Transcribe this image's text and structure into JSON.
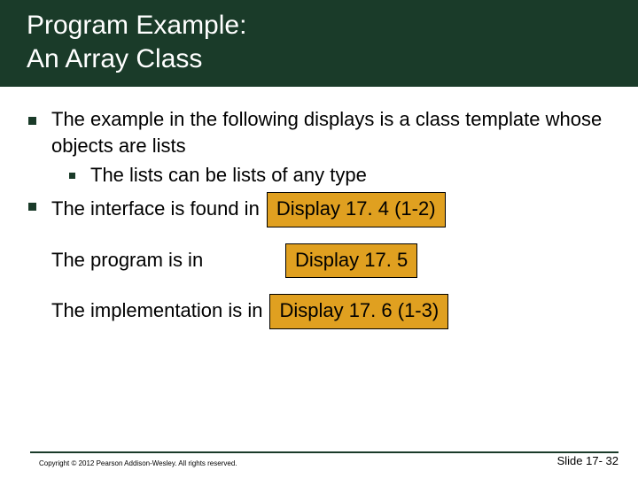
{
  "title": {
    "line1": "Program Example:",
    "line2": "An Array Class"
  },
  "content": {
    "bullet1": "The example in the following displays is a class template whose objects are lists",
    "sub1": "The lists can be lists of any type",
    "bullet2_text": "The interface is found in",
    "bullet2_link": "Display 17. 4 (1-2)",
    "line3_text": "The program is in",
    "line3_link": "Display 17. 5",
    "line4_text": "The implementation is in",
    "line4_link": "Display 17. 6 (1-3)"
  },
  "footer": {
    "copyright": "Copyright © 2012 Pearson Addison-Wesley.  All rights reserved.",
    "slide": "Slide 17- 32"
  }
}
